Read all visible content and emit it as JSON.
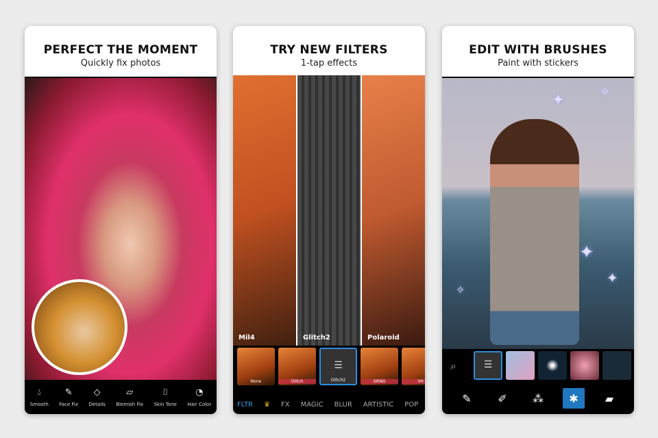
{
  "panels": [
    {
      "title": "PERFECT THE MOMENT",
      "subtitle": "Quickly fix photos",
      "tools": [
        {
          "label": "Smooth",
          "icon": "drop-icon"
        },
        {
          "label": "Face Fix",
          "icon": "brush-icon"
        },
        {
          "label": "Details",
          "icon": "diamond-icon"
        },
        {
          "label": "Blemish Fix",
          "icon": "bandage-icon"
        },
        {
          "label": "Skin Tone",
          "icon": "tube-icon"
        },
        {
          "label": "Hair Color",
          "icon": "hair-icon"
        }
      ]
    },
    {
      "title": "TRY NEW FILTERS",
      "subtitle": "1-tap effects",
      "previews": [
        "Mil4",
        "Glitch2",
        "Polaroid"
      ],
      "thumbs": [
        "None",
        "Glitch",
        "Glitch2",
        "GRNG",
        "VH"
      ],
      "tabs": [
        "FLTR",
        "FX",
        "MAGIC",
        "BLUR",
        "ARTISTIC",
        "POP"
      ]
    },
    {
      "title": "EDIT WITH BRUSHES",
      "subtitle": "Paint with stickers",
      "brushes": [
        "brush-icon",
        "brush-dashed-icon",
        "magic-brush-icon",
        "sticker-brush-icon",
        "eraser-icon"
      ]
    }
  ],
  "colors": {
    "accent": "#2d8fe0",
    "background": "#ececec"
  }
}
